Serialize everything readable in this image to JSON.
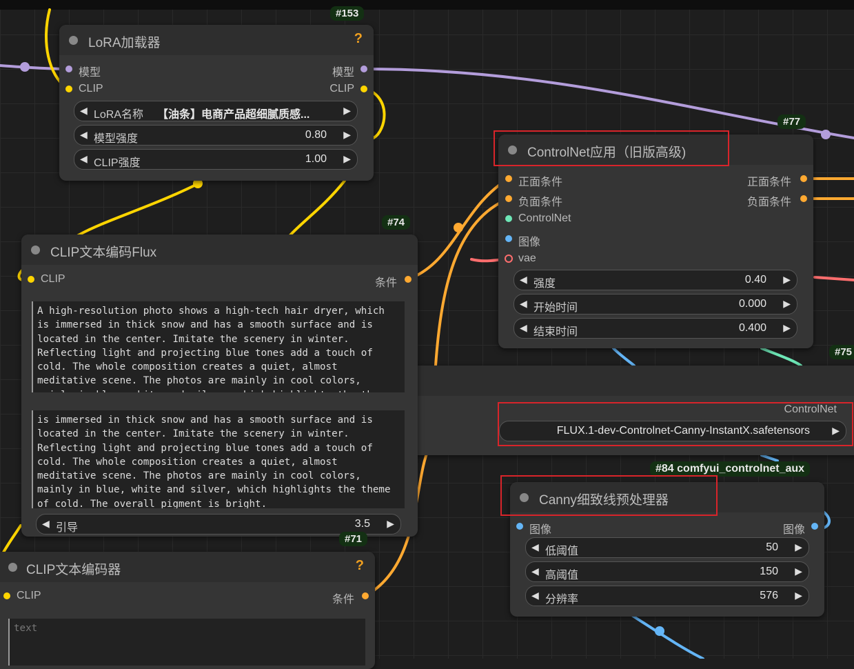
{
  "lora_node": {
    "badge": "#153",
    "title": "LoRA加载器",
    "help": "?",
    "in_model": "模型",
    "out_model": "模型",
    "in_clip": "CLIP",
    "out_clip": "CLIP",
    "widgets": [
      {
        "label": "LoRA名称",
        "value": "【油条】电商产品超细腻质感..."
      },
      {
        "label": "模型强度",
        "value": "0.80"
      },
      {
        "label": "CLIP强度",
        "value": "1.00"
      }
    ]
  },
  "clip_flux_node": {
    "badge": "#74",
    "title": "CLIP文本编码Flux",
    "in_clip": "CLIP",
    "out_cond": "条件",
    "text_top": "A high-resolution photo shows a high-tech hair dryer, which\nis immersed in thick snow and has a smooth surface and is\nlocated in the center. Imitate the scenery in winter.\nReflecting light and projecting blue tones add a touch of\ncold. The whole composition creates a quiet, almost\nmeditative scene. The photos are mainly in cool colors,\nmainly in blue, white and silver, which highlights the theme",
    "text_bottom": "is immersed in thick snow and has a smooth surface and is\nlocated in the center. Imitate the scenery in winter.\nReflecting light and projecting blue tones add a touch of\ncold. The whole composition creates a quiet, almost\nmeditative scene. The photos are mainly in cool colors,\nmainly in blue, white and silver, which highlights the theme\nof cold. The overall pigment is bright.",
    "guidance_label": "引导",
    "guidance_value": "3.5"
  },
  "clip_encoder_node": {
    "badge": "#71",
    "title": "CLIP文本编码器",
    "help": "?",
    "in_clip": "CLIP",
    "out_cond": "条件",
    "placeholder": "text"
  },
  "controlnet_apply_node": {
    "badge": "#77",
    "title": "ControlNet应用（旧版高级)",
    "inputs": [
      "正面条件",
      "负面条件",
      "ControlNet",
      "图像",
      "vae"
    ],
    "outputs": [
      "正面条件",
      "负面条件"
    ],
    "widgets": [
      {
        "label": "强度",
        "value": "0.40"
      },
      {
        "label": "开始时间",
        "value": "0.000"
      },
      {
        "label": "结束时间",
        "value": "0.400"
      }
    ]
  },
  "controlnet_loader_node": {
    "badge": "#75",
    "out_label": "ControlNet",
    "model_value": "FLUX.1-dev-Controlnet-Canny-InstantX.safetensors"
  },
  "canny_node": {
    "badge": "#84 comfyui_controlnet_aux",
    "title": "Canny细致线预处理器",
    "in_image": "图像",
    "out_image": "图像",
    "widgets": [
      {
        "label": "低阈值",
        "value": "50"
      },
      {
        "label": "高阈值",
        "value": "150"
      },
      {
        "label": "分辨率",
        "value": "576"
      }
    ]
  },
  "colors": {
    "model_wire": "#b39ddb",
    "clip_wire": "#ffd500",
    "cond_wire": "#ffa931",
    "controlnet_wire": "#6ee7b7",
    "image_wire": "#64b5f6",
    "vae_wire": "#ff6e6e",
    "highlight_box": "#d9242a"
  }
}
